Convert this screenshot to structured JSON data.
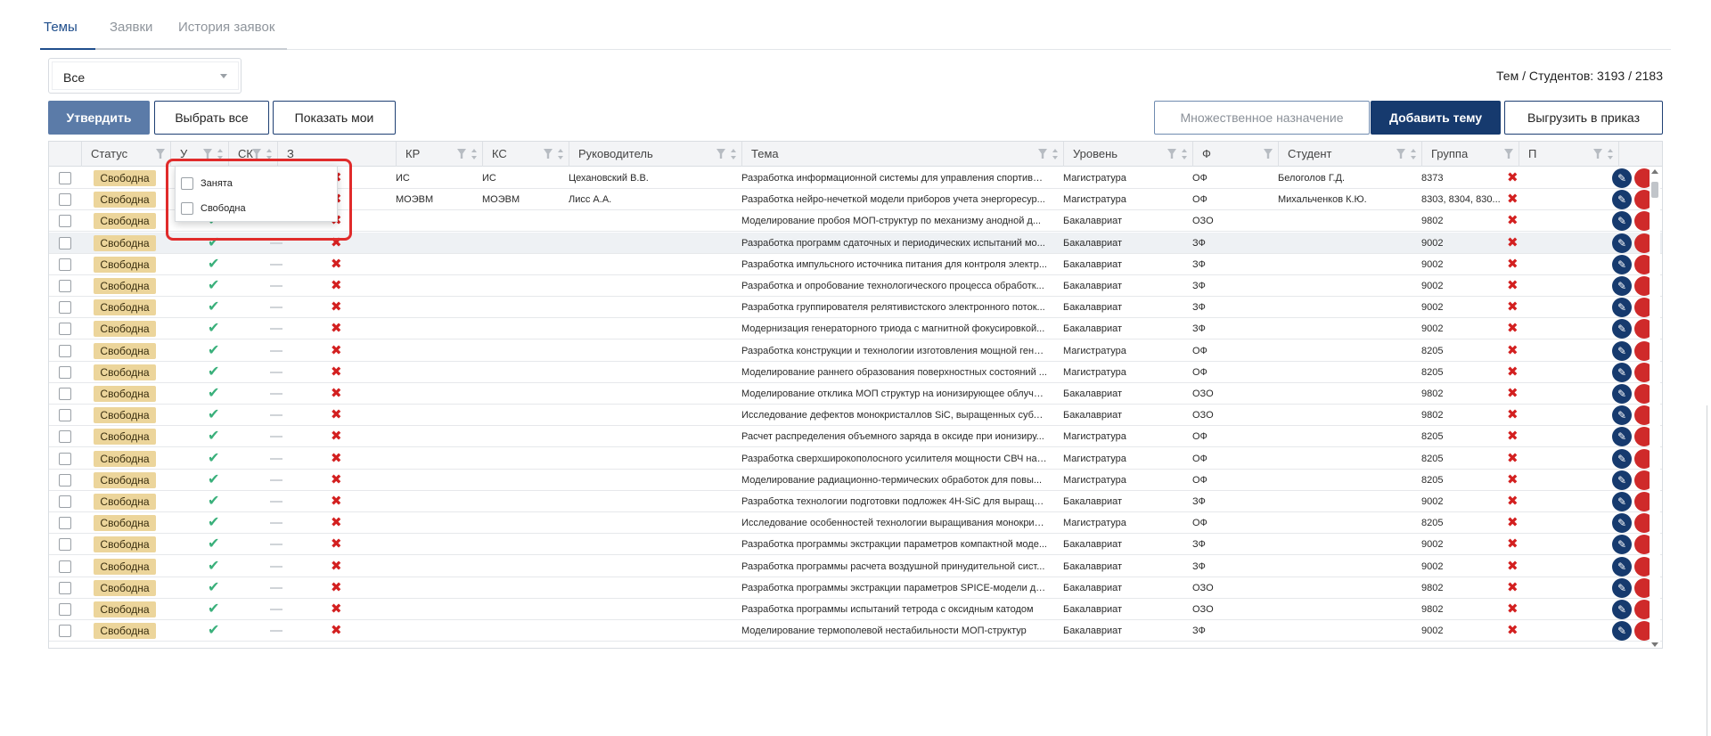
{
  "tabs": [
    {
      "label": "Темы",
      "active": true
    },
    {
      "label": "Заявки",
      "active": false
    },
    {
      "label": "История заявок",
      "active": false
    }
  ],
  "filter_select": {
    "value": "Все"
  },
  "counter": "Тем / Студентов: 3193 / 2183",
  "toolbar": {
    "confirm": "Утвердить",
    "select_all": "Выбрать все",
    "show_mine": "Показать мои",
    "multi_assign": "Множественное назначение",
    "add_topic": "Добавить тему",
    "export_order": "Выгрузить в приказ"
  },
  "columns": [
    "Статус",
    "У",
    "СК",
    "З",
    "КР",
    "КС",
    "Руководитель",
    "Тема",
    "Уровень",
    "Ф",
    "Студент",
    "Группа",
    "П"
  ],
  "filter_dropdown": {
    "options": [
      "Занята",
      "Свободна"
    ]
  },
  "rows": [
    {
      "status": "Свободна",
      "kr": "ИС",
      "ks": "ИС",
      "supervisor": "Цехановский В.В.",
      "topic": "Разработка информационной системы для управления спортивно...",
      "level": "Магистратура",
      "form": "ОФ",
      "student": "Белоголов Г.Д.",
      "group": "8373"
    },
    {
      "status": "Свободна",
      "kr": "МОЭВМ",
      "ks": "МОЭВМ",
      "supervisor": "Лисс А.А.",
      "topic": "Разработка нейро-нечеткой модели приборов учета энергоресур...",
      "level": "Магистратура",
      "form": "ОФ",
      "student": "Михальченков К.Ю.",
      "group": "8303, 8304, 830..."
    },
    {
      "status": "Свободна",
      "kr": "",
      "ks": "",
      "supervisor": "",
      "topic": "Моделирование пробоя МОП-структур по механизму анодной д...",
      "level": "Бакалавриат",
      "form": "ОЗО",
      "student": "",
      "group": "9802"
    },
    {
      "status": "Свободна",
      "kr": "",
      "ks": "",
      "supervisor": "",
      "topic": "Разработка программ сдаточных и периодических испытаний мо...",
      "level": "Бакалавриат",
      "form": "ЗФ",
      "student": "",
      "group": "9002"
    },
    {
      "status": "Свободна",
      "kr": "",
      "ks": "",
      "supervisor": "",
      "topic": "Разработка импульсного источника питания для контроля электр...",
      "level": "Бакалавриат",
      "form": "ЗФ",
      "student": "",
      "group": "9002"
    },
    {
      "status": "Свободна",
      "kr": "",
      "ks": "",
      "supervisor": "",
      "topic": "Разработка и опробование технологического процесса обработк...",
      "level": "Бакалавриат",
      "form": "ЗФ",
      "student": "",
      "group": "9002"
    },
    {
      "status": "Свободна",
      "kr": "",
      "ks": "",
      "supervisor": "",
      "topic": "Разработка группирователя релятивистского электронного поток...",
      "level": "Бакалавриат",
      "form": "ЗФ",
      "student": "",
      "group": "9002"
    },
    {
      "status": "Свободна",
      "kr": "",
      "ks": "",
      "supervisor": "",
      "topic": "Модернизация генераторного триода с магнитной фокусировкой...",
      "level": "Бакалавриат",
      "form": "ЗФ",
      "student": "",
      "group": "9002"
    },
    {
      "status": "Свободна",
      "kr": "",
      "ks": "",
      "supervisor": "",
      "topic": "Разработка конструкции и технологии изготовления мощной гене...",
      "level": "Магистратура",
      "form": "ОФ",
      "student": "",
      "group": "8205"
    },
    {
      "status": "Свободна",
      "kr": "",
      "ks": "",
      "supervisor": "",
      "topic": "Моделирование раннего образования поверхностных состояний ...",
      "level": "Магистратура",
      "form": "ОФ",
      "student": "",
      "group": "8205"
    },
    {
      "status": "Свободна",
      "kr": "",
      "ks": "",
      "supervisor": "",
      "topic": "Моделирование отклика МОП структур на ионизирующее облуче...",
      "level": "Бакалавриат",
      "form": "ОЗО",
      "student": "",
      "group": "9802"
    },
    {
      "status": "Свободна",
      "kr": "",
      "ks": "",
      "supervisor": "",
      "topic": "Исследование дефектов монокристаллов SiC, выращенных субли...",
      "level": "Бакалавриат",
      "form": "ОЗО",
      "student": "",
      "group": "9802"
    },
    {
      "status": "Свободна",
      "kr": "",
      "ks": "",
      "supervisor": "",
      "topic": "Расчет распределения объемного заряда в оксиде при ионизиру...",
      "level": "Магистратура",
      "form": "ОФ",
      "student": "",
      "group": "8205"
    },
    {
      "status": "Свободна",
      "kr": "",
      "ks": "",
      "supervisor": "",
      "topic": "Разработка сверхширокополосного усилителя мощности СВЧ на т...",
      "level": "Магистратура",
      "form": "ОФ",
      "student": "",
      "group": "8205"
    },
    {
      "status": "Свободна",
      "kr": "",
      "ks": "",
      "supervisor": "",
      "topic": "Моделирование радиационно-термических обработок для повы...",
      "level": "Магистратура",
      "form": "ОФ",
      "student": "",
      "group": "8205"
    },
    {
      "status": "Свободна",
      "kr": "",
      "ks": "",
      "supervisor": "",
      "topic": "Разработка технологии подготовки подложек 4H-SiC для выращи...",
      "level": "Бакалавриат",
      "form": "ЗФ",
      "student": "",
      "group": "9002"
    },
    {
      "status": "Свободна",
      "kr": "",
      "ks": "",
      "supervisor": "",
      "topic": "Исследование особенностей технологии выращивания монокрис...",
      "level": "Магистратура",
      "form": "ОФ",
      "student": "",
      "group": "8205"
    },
    {
      "status": "Свободна",
      "kr": "",
      "ks": "",
      "supervisor": "",
      "topic": "Разработка программы экстракции параметров компактной моде...",
      "level": "Бакалавриат",
      "form": "ЗФ",
      "student": "",
      "group": "9002"
    },
    {
      "status": "Свободна",
      "kr": "",
      "ks": "",
      "supervisor": "",
      "topic": "Разработка программы расчета воздушной принудительной сист...",
      "level": "Бакалавриат",
      "form": "ЗФ",
      "student": "",
      "group": "9002"
    },
    {
      "status": "Свободна",
      "kr": "",
      "ks": "",
      "supervisor": "",
      "topic": "Разработка программы экстракции параметров SPICE-модели ди...",
      "level": "Бакалавриат",
      "form": "ОЗО",
      "student": "",
      "group": "9802"
    },
    {
      "status": "Свободна",
      "kr": "",
      "ks": "",
      "supervisor": "",
      "topic": "Разработка программы испытаний тетрода с оксидным катодом",
      "level": "Бакалавриат",
      "form": "ОЗО",
      "student": "",
      "group": "9802"
    },
    {
      "status": "Свободна",
      "kr": "",
      "ks": "",
      "supervisor": "",
      "topic": "Моделирование термополевой нестабильности МОП-структур",
      "level": "Бакалавриат",
      "form": "ЗФ",
      "student": "",
      "group": "9002"
    }
  ],
  "colors": {
    "accent": "#163a6e",
    "status_bg": "#ecd59b",
    "ok": "#3ab07b",
    "no": "#d32020"
  },
  "icons": {
    "edit": "pencil-icon",
    "delete": "delete-icon",
    "check": "check-icon",
    "cross": "cross-icon",
    "filter": "filter-icon",
    "sort": "sort-icon"
  }
}
